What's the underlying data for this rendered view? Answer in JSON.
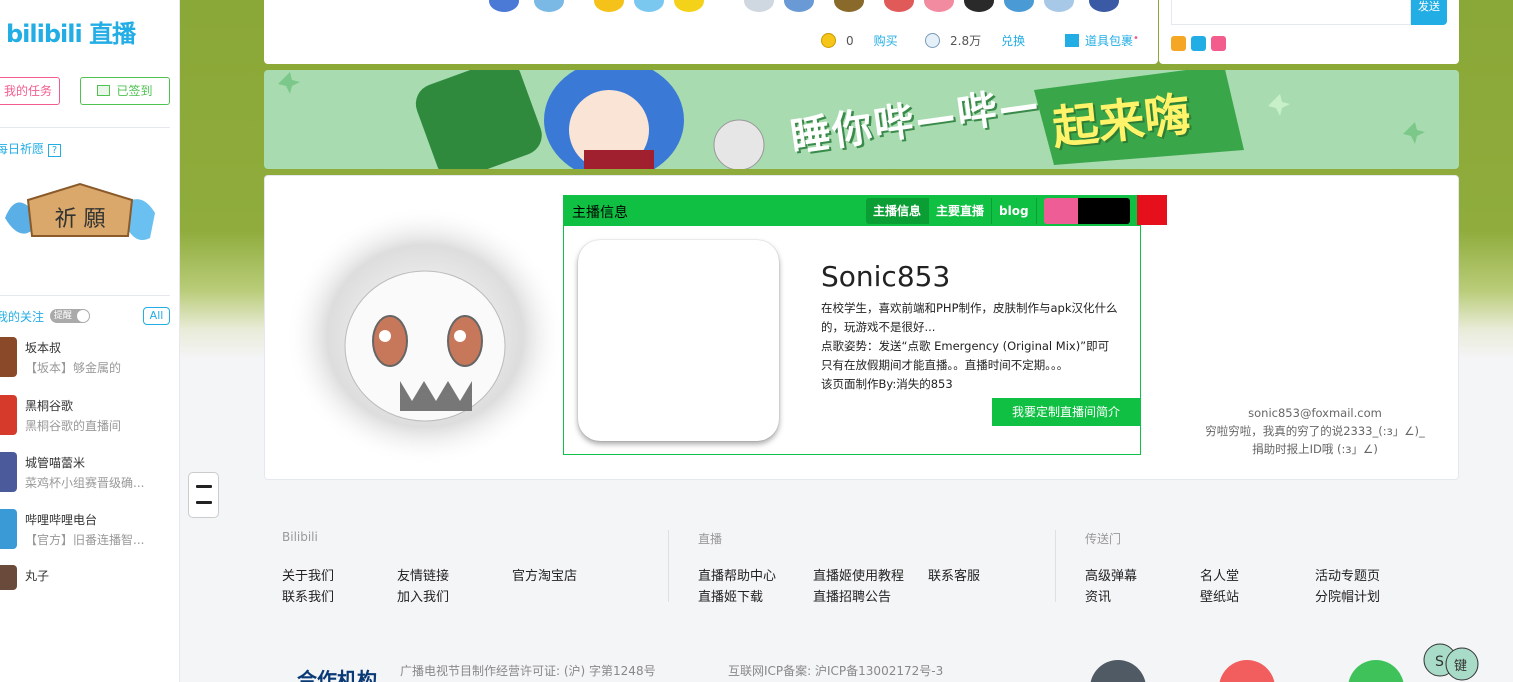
{
  "sidebar": {
    "logo": "bilibili 直播",
    "task_button": "我的任务",
    "signed_button": "已签到",
    "wish_title": "每日祈愿",
    "wish_help": "?",
    "wish_image_text": "祈 願",
    "follow_title": "我的关注",
    "follow_toggle": "提醒",
    "follow_all": "All",
    "follows": [
      {
        "name": "坂本叔",
        "sub": "【坂本】够金属的",
        "color": "#8a4a2a"
      },
      {
        "name": "黑桐谷歌",
        "sub": "黑桐谷歌的直播间",
        "color": "#d63a2a"
      },
      {
        "name": "城管喵蕾米",
        "sub": "菜鸡杯小组赛晋级确...",
        "color": "#4a5a9a"
      },
      {
        "name": "哔哩哔哩电台",
        "sub": "【官方】旧番连播智...",
        "color": "#3a9ad6"
      },
      {
        "name": "丸子",
        "sub": "",
        "color": "#6a4a3a"
      }
    ]
  },
  "gift_bar": {
    "gold_value": "0",
    "gold_action": "购买",
    "silver_value": "2.8万",
    "silver_action": "兑换",
    "bag_label": "道具包裹",
    "bag_dot": "•",
    "sticker_colors": [
      "#4a7ad6",
      "#7ab8e6",
      "#f5c21a",
      "#7ac8f0",
      "#f5d21a",
      "#cfd8e0",
      "#6a9ad6",
      "#8a6a2a",
      "#e05a5a",
      "#f28aa0",
      "#2a2a2a",
      "#4a9ad6",
      "#a8c8e8",
      "#3a5aa6"
    ]
  },
  "chat": {
    "send_label": "发送",
    "mini_icon_colors": [
      "#f5a623",
      "#23ade5",
      "#f25d8e"
    ]
  },
  "banner": {
    "slogan": "睡你哔—哔—",
    "slogan_highlight": "起来嗨"
  },
  "host_panel": {
    "title": "主播信息",
    "tabs": [
      "主播信息",
      "主要直播",
      "blog"
    ],
    "username": "Sonic853",
    "description_lines": [
      "在校学生，喜欢前端和PHP制作，皮肤制作与apk汉化什么",
      "的，玩游戏不是很好...",
      "点歌姿势：发送“点歌 Emergency (Original Mix)”即可",
      "只有在放假期间才能直播。。直播时间不定期。。。",
      "该页面制作By:消失的853"
    ],
    "custom_button": "我要定制直播间简介",
    "swatch_colors": [
      "#ee5d95",
      "#000000",
      "#e5101c"
    ]
  },
  "contact": {
    "email": "sonic853@foxmail.com",
    "line2": "穷啦穷啦，我真的穷了的说2333_(:з」∠)_",
    "line3": "捐助时报上ID哦 (:з」∠)"
  },
  "footer": {
    "columns": [
      {
        "title": "Bilibili",
        "links": [
          "关于我们",
          "友情链接",
          "官方淘宝店",
          "联系我们",
          "加入我们"
        ]
      },
      {
        "title": "直播",
        "links": [
          "直播帮助中心",
          "直播姬使用教程",
          "联系客服",
          "直播姬下载",
          "直播招聘公告"
        ]
      },
      {
        "title": "传送门",
        "links": [
          "高级弹幕",
          "名人堂",
          "活动专题页",
          "资讯",
          "壁纸站",
          "分院帽计划"
        ]
      }
    ],
    "coop_label": "合作机构",
    "license": "广播电视节目制作经营许可证: (沪) 字第1248号",
    "icp": "互联网ICP备案: 沪ICP备13002172号-3",
    "float_keys": [
      "S",
      "键"
    ],
    "social_colors": [
      "#505a64",
      "#f25d5d",
      "#3fc25a"
    ]
  }
}
